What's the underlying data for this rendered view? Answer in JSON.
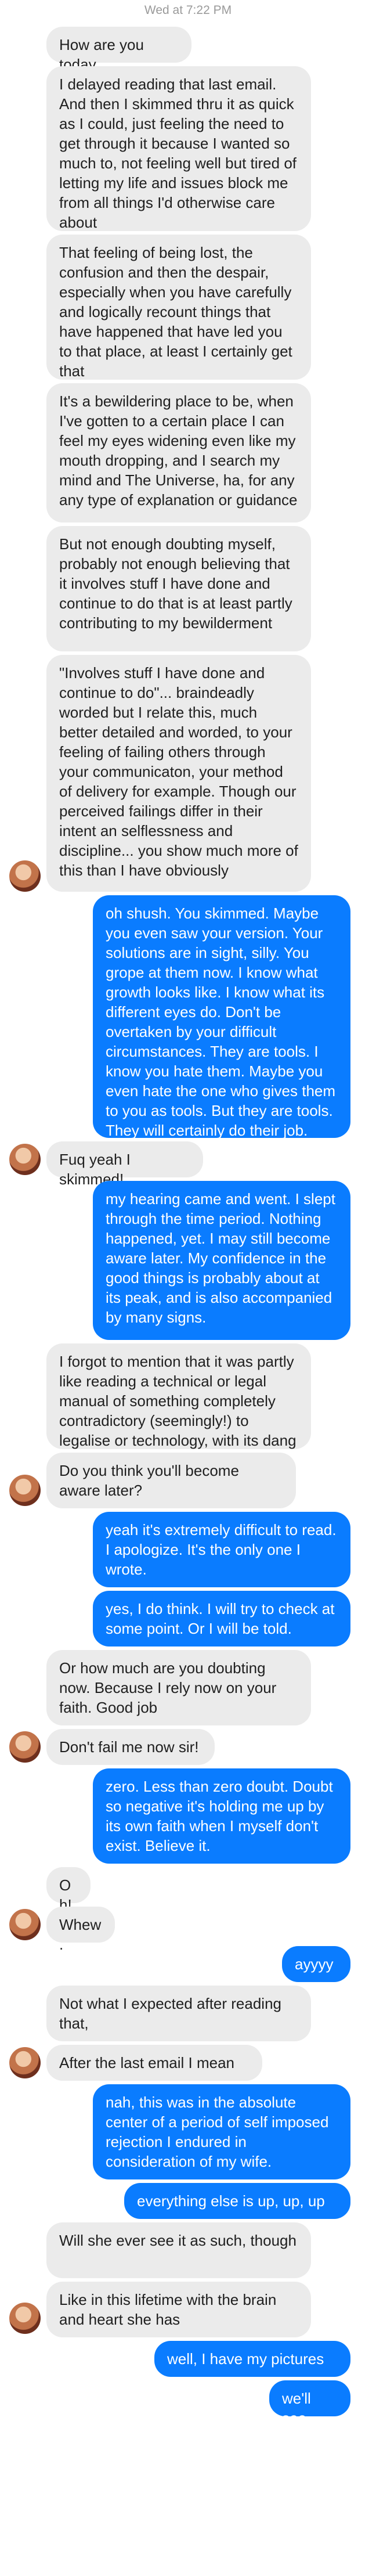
{
  "thread": {
    "timestamp": "Wed at 7:22 PM",
    "messages": [
      {
        "from": "them",
        "text": "How are you today"
      },
      {
        "from": "them",
        "text": "I delayed reading that last email. And then I skimmed thru it as quick as I could, just feeling the need to get through it because I wanted so much to, not feeling well but tired of letting my life and issues block me from all things I'd otherwise care about"
      },
      {
        "from": "them",
        "text": "That feeling of being lost, the confusion and then the despair, especially when you have carefully and logically recount things that have happened that have led you to that place, at least I certainly get that"
      },
      {
        "from": "them",
        "text": "It's a bewildering place to be, when I've gotten to a certain place I can feel my eyes widening even like my mouth dropping, and I search my mind and The Universe, ha, for any any type of explanation or guidance"
      },
      {
        "from": "them",
        "text": "But not enough doubting myself, probably not enough believing that it involves stuff I have done and continue to do that is at least partly contributing to my bewilderment"
      },
      {
        "from": "them",
        "text": "\"Involves stuff I have done and continue to do\"... braindeadly worded but I relate this, much better detailed and worded, to your feeling of failing others through your communicaton, your method of delivery for example. Though our perceived failings differ in their intent an selflessness and discipline... you show much more of this than I have obviously"
      },
      {
        "from": "me",
        "text": "oh shush. You skimmed. Maybe you even saw your version. Your solutions are in sight, silly. You grope at them now. I know what growth looks like. I know what its different eyes do. Don't be overtaken by your difficult circumstances. They are tools. I know you hate them. Maybe you even hate the one who gives them to you as tools. But they are tools. They will certainly do their job."
      },
      {
        "from": "them",
        "text": "Fuq yeah I skimmed!"
      },
      {
        "from": "me",
        "text": "my hearing came and went. I slept through the time period. Nothing happened, yet. I may still become aware later. My confidence in the good things is probably about at its peak, and is also accompanied by many signs."
      },
      {
        "from": "them",
        "text": "I forgot to mention that it was partly like reading a technical or legal manual of something completely contradictory (seemingly!) to legalise or technology, with its dang abstract spiritual themes"
      },
      {
        "from": "them",
        "text": "Do you think you'll become aware later?"
      },
      {
        "from": "me",
        "text": "yeah it's extremely difficult to read. I apologize. It's the only one I wrote."
      },
      {
        "from": "me",
        "text": "yes, I do think. I will try to check at some point. Or I will be told."
      },
      {
        "from": "them",
        "text": "Or how much are you doubting now. Because I rely now on your faith. Good job"
      },
      {
        "from": "them",
        "text": "Don't fail me now sir!"
      },
      {
        "from": "me",
        "text": "zero. Less than zero doubt. Doubt so negative it's holding me up by its own faith when I myself don't exist. Believe it."
      },
      {
        "from": "them",
        "text": "Oh!"
      },
      {
        "from": "them",
        "text": "Whew."
      },
      {
        "from": "me",
        "text": "ayyyy"
      },
      {
        "from": "them",
        "text": "Not what I expected after reading that,"
      },
      {
        "from": "them",
        "text": "After the last email I mean"
      },
      {
        "from": "me",
        "text": "nah, this was in the absolute center of a period of self imposed rejection I endured in consideration of my wife."
      },
      {
        "from": "me",
        "text": "everything else is up, up, up"
      },
      {
        "from": "them",
        "text": "Will she ever see it as such, though"
      },
      {
        "from": "them",
        "text": "Like in this lifetime with the brain and heart she has"
      },
      {
        "from": "me",
        "text": "well, I have my pictures"
      },
      {
        "from": "me",
        "text": "we'll see"
      }
    ]
  }
}
